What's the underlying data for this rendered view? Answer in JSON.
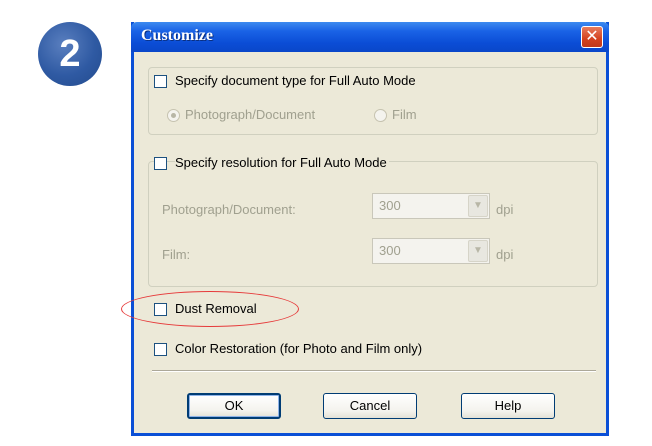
{
  "step_badge": {
    "number": "2"
  },
  "dialog": {
    "title": "Customize",
    "close_glyph": "✕",
    "doc_type_group": {
      "checkbox_label": "Specify document type for Full Auto Mode",
      "checked": false,
      "radio_photo": "Photograph/Document",
      "radio_film": "Film",
      "selected": "Photograph/Document",
      "enabled": false
    },
    "resolution_group": {
      "checkbox_label": "Specify resolution for Full Auto Mode",
      "checked": false,
      "photo_label": "Photograph/Document:",
      "photo_value": "300",
      "film_label": "Film:",
      "film_value": "300",
      "unit": "dpi",
      "enabled": false
    },
    "dust_removal": {
      "label": "Dust Removal",
      "checked": false,
      "highlighted": true
    },
    "color_restoration": {
      "label": "Color Restoration (for Photo and Film only)",
      "checked": false
    },
    "buttons": {
      "ok": "OK",
      "cancel": "Cancel",
      "help": "Help"
    }
  },
  "colors": {
    "titlebar": "#0b4dd6",
    "dialog_bg": "#ece9d8",
    "highlight": "#e63a3a",
    "badge": "#2f5aa3"
  },
  "icons": {
    "close": "close-icon",
    "dropdown": "chevron-down-icon"
  }
}
